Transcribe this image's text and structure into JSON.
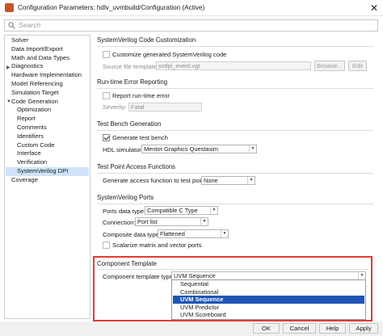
{
  "window": {
    "title": "Configuration Parameters: hdlv_uvmbuild/Configuration (Active)",
    "close_glyph": "✕"
  },
  "search": {
    "placeholder": "Search"
  },
  "tree": {
    "items": [
      {
        "label": "Solver"
      },
      {
        "label": "Data Import/Export"
      },
      {
        "label": "Math and Data Types"
      },
      {
        "label": "Diagnostics",
        "expander": "▶"
      },
      {
        "label": "Hardware Implementation"
      },
      {
        "label": "Model Referencing"
      },
      {
        "label": "Simulation Target"
      },
      {
        "label": "Code Generation",
        "expander": "▼"
      },
      {
        "label": "Optimization"
      },
      {
        "label": "Report"
      },
      {
        "label": "Comments"
      },
      {
        "label": "Identifiers"
      },
      {
        "label": "Custom Code"
      },
      {
        "label": "Interface"
      },
      {
        "label": "Verification"
      },
      {
        "label": "SystemVerilog DPI",
        "selected": true
      },
      {
        "label": "Coverage"
      }
    ]
  },
  "sections": {
    "customization": {
      "title": "SystemVerilog Code Customization",
      "checkbox_label": "Customize generated SystemVerilog code",
      "source_label": "Source file template:",
      "source_value": "svdpi_event.vgt",
      "browse": "Browse...",
      "edit": "Edit"
    },
    "runtime": {
      "title": "Run-time Error Reporting",
      "checkbox_label": "Report run-time error",
      "severity_label": "Severity:",
      "severity_value": "Fatal"
    },
    "testbench": {
      "title": "Test Bench Generation",
      "checkbox_label": "Generate test bench",
      "simulator_label": "HDL simulator:",
      "simulator_value": "Mentor Graphics Questasim"
    },
    "testpoint": {
      "title": "Test Point Access Functions",
      "label": "Generate access function to test point:",
      "value": "None"
    },
    "ports": {
      "title": "SystemVerilog Ports",
      "data_type_label": "Ports data type:",
      "data_type_value": "Compatible C Type",
      "connection_label": "Connection:",
      "connection_value": "Port list",
      "composite_label": "Composite data type:",
      "composite_value": "Flattened",
      "scalarize_label": "Scalarize matrix and vector ports"
    },
    "component": {
      "title": "Component Template",
      "type_label": "Component template type:",
      "type_value": "UVM Sequence",
      "options": [
        "Sequential",
        "Combinational",
        "UVM Sequence",
        "UVM Predictor",
        "UVM Scoreboard"
      ],
      "selected_index": 2
    }
  },
  "footer": {
    "ok": "OK",
    "cancel": "Cancel",
    "help": "Help",
    "apply": "Apply"
  },
  "colors": {
    "selection": "#1e55b4",
    "tree_selection": "#cfe4f9",
    "highlight_border": "#e53935"
  }
}
